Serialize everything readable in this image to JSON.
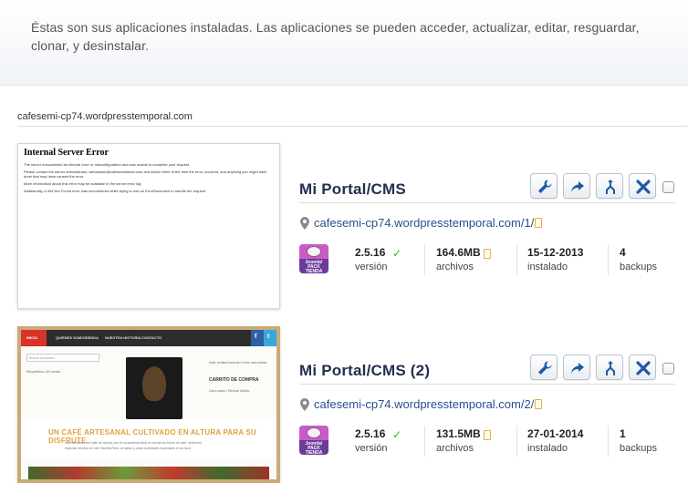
{
  "intro": {
    "text": "Éstas son sus aplicaciones instaladas. Las aplicaciones se pueden acceder, actualizar, editar, resguardar, clonar, y desinstalar."
  },
  "domain": "cafesemi-cp74.wordpresstemporal.com",
  "preview1": {
    "title": "Internal Server Error",
    "lines": [
      "The server encountered an internal error or misconfiguration and was unable to complete your request.",
      "Please contact the server administrator, webmaster@cafesemillareal.com and inform them of the time the error occurred, and anything you might have done that may have caused the error.",
      "More information about this error may be available in the server error log.",
      "Additionally, a 404 Not Found error was encountered while trying to use an ErrorDocument to handle the request."
    ]
  },
  "preview2": {
    "nav": [
      "INICIO",
      "QUIÉNES SOMOS",
      "TIENDA",
      "NUESTRA HISTORIA",
      "CONTACTO"
    ],
    "search_placeholder": "Buscar productos...",
    "links": "Mis pedidos  |  Mi cuenta",
    "cart_top": "Hola, Invitado  Acceder   Crear una cuenta",
    "cart_title": "CARRITO DE COMPRA",
    "cart_sub": "Carro vacío  |  Revisar Carrito",
    "banner_title": "UN CAFÉ ARTESANAL CULTIVADO EN ALTURA PARA SU DISFRUTE",
    "banner_lines": [
      "Las montañas del Valle de Alturia, son el ecosistema ideal en donde los frutos de café, selección",
      "regional, brindan al Café Semilla Real, un sabor y unas cualidades especiales en su taza"
    ]
  },
  "icon_badge": {
    "brand": "Joomla!",
    "caption": "PACK TIENDA BOUTIQUE"
  },
  "apps": [
    {
      "title": "Mi Portal/CMS",
      "url": "cafesemi-cp74.wordpresstemporal.com/1/",
      "stats": [
        {
          "value": "2.5.16",
          "label": "versión"
        },
        {
          "value": "164.6MB",
          "label": "archivos"
        },
        {
          "value": "15-12-2013",
          "label": "instalado"
        },
        {
          "value": "4",
          "label": "backups"
        }
      ]
    },
    {
      "title": "Mi Portal/CMS (2)",
      "url": "cafesemi-cp74.wordpresstemporal.com/2/",
      "stats": [
        {
          "value": "2.5.16",
          "label": "versión"
        },
        {
          "value": "131.5MB",
          "label": "archivos"
        },
        {
          "value": "27-01-2014",
          "label": "instalado"
        },
        {
          "value": "1",
          "label": "backups"
        }
      ]
    }
  ],
  "icons": {
    "wrench": "wrench-icon",
    "share": "share-arrow-icon",
    "clone": "clone-icon",
    "delete": "close-x-icon",
    "location": "map-pin-icon",
    "external": "external-link-icon",
    "check": "check-icon"
  },
  "colors": {
    "title": "#222f4e",
    "link": "#26508e",
    "icon_blue": "#1f5aa8",
    "check": "#3bab3b",
    "accent_red": "#d8322b",
    "thumb_border": "#c9ab78"
  }
}
